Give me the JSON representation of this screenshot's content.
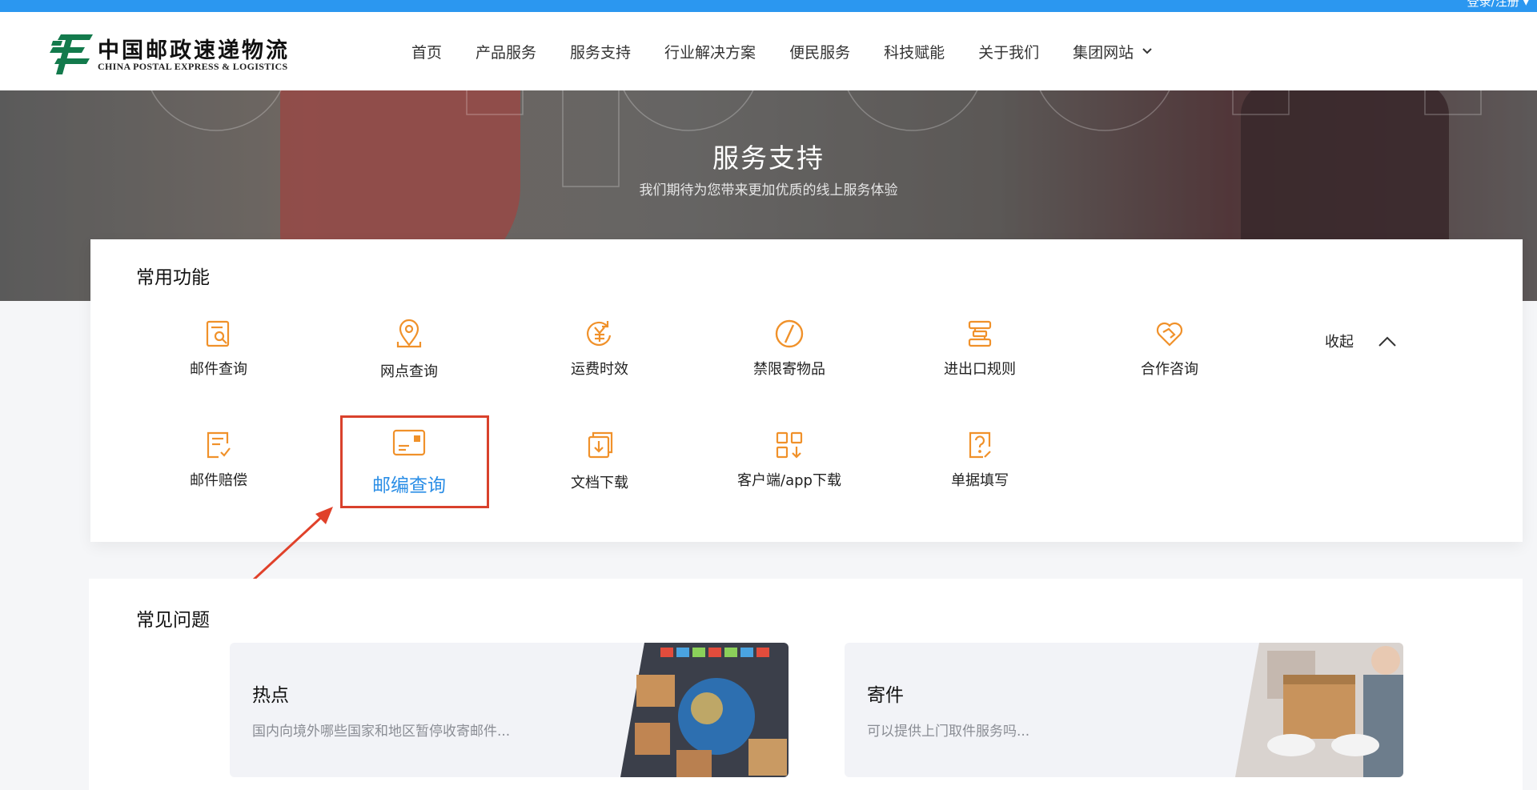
{
  "topbar": {
    "links": "登录/注册 ▾"
  },
  "brand": {
    "name_cn": "中国邮政速递物流",
    "name_en": "CHINA POSTAL EXPRESS & LOGISTICS",
    "color": "#137a4c"
  },
  "nav": {
    "items": [
      {
        "label": "首页"
      },
      {
        "label": "产品服务"
      },
      {
        "label": "服务支持"
      },
      {
        "label": "行业解决方案"
      },
      {
        "label": "便民服务"
      },
      {
        "label": "科技赋能"
      },
      {
        "label": "关于我们"
      },
      {
        "label": "集团网站"
      }
    ]
  },
  "hero": {
    "title": "服务支持",
    "subtitle": "我们期待为您带来更加优质的线上服务体验"
  },
  "common_functions": {
    "title": "常用功能",
    "collapse_label": "收起",
    "accent_color": "#f0912a",
    "items": [
      {
        "label": "邮件查询",
        "icon": "mail-search-icon"
      },
      {
        "label": "网点查询",
        "icon": "location-pin-icon"
      },
      {
        "label": "运费时效",
        "icon": "yen-clock-icon"
      },
      {
        "label": "禁限寄物品",
        "icon": "prohibited-icon"
      },
      {
        "label": "进出口规则",
        "icon": "rules-icon"
      },
      {
        "label": "合作咨询",
        "icon": "handshake-heart-icon"
      },
      {
        "label": "邮件赔偿",
        "icon": "compensation-doc-icon"
      },
      {
        "label": "邮编查询",
        "icon": "postcode-card-icon"
      },
      {
        "label": "文档下载",
        "icon": "doc-download-icon"
      },
      {
        "label": "客户端/app下载",
        "icon": "app-grid-download-icon"
      },
      {
        "label": "单据填写",
        "icon": "form-question-icon"
      }
    ]
  },
  "faq": {
    "title": "常见问题",
    "cards": [
      {
        "heading": "热点",
        "desc": "国内向境外哪些国家和地区暂停收寄邮件..."
      },
      {
        "heading": "寄件",
        "desc": "可以提供上门取件服务吗..."
      }
    ]
  }
}
